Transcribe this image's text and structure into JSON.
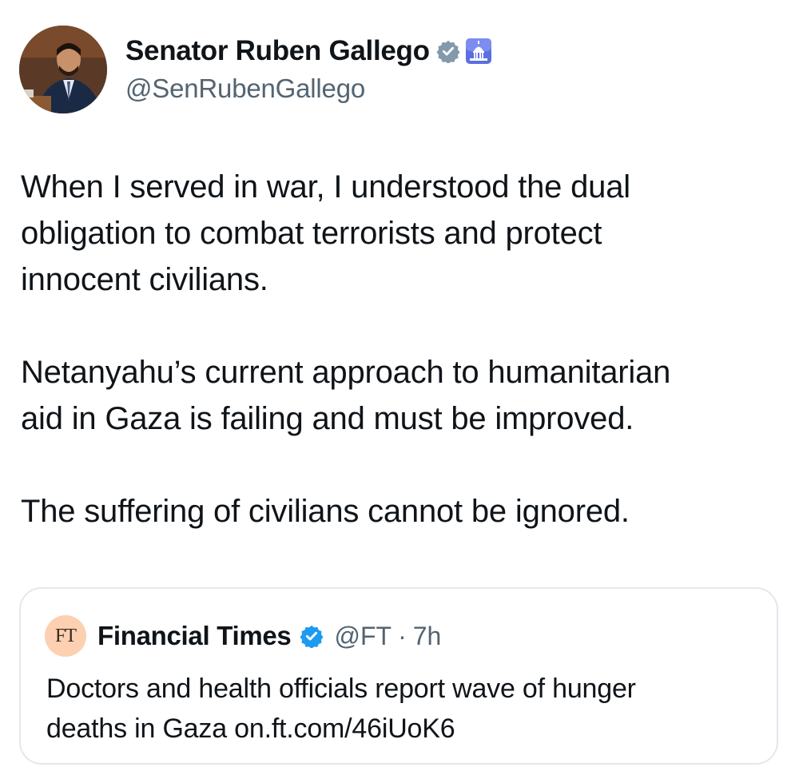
{
  "tweet": {
    "author": {
      "display_name": "Senator Ruben Gallego",
      "handle": "@SenRubenGallego",
      "avatar_icon": "profile-photo",
      "badges": [
        "government-verified-badge-icon",
        "capitol-affiliate-icon"
      ]
    },
    "body": {
      "paragraphs": [
        "When I served in war, I understood the dual\nobligation to combat terrorists and protect\ninnocent civilians.",
        "Netanyahu’s current approach to humanitarian\naid in Gaza is failing and must be improved.",
        "The suffering of civilians cannot be ignored."
      ]
    },
    "quoted": {
      "logo_text": "FT",
      "display_name": "Financial Times",
      "handle": "@FT",
      "separator": "·",
      "time": "7h",
      "text": "Doctors and health officials report wave of hunger\ndeaths in Gaza on.ft.com/46iUoK6"
    }
  },
  "colors": {
    "text_primary": "#0f1419",
    "text_secondary": "#536471",
    "verified_blue": "#1d9bf0",
    "gov_gray": "#829aab",
    "ft_logo_bg": "#fcd0b1",
    "border": "#e1e8ed"
  }
}
